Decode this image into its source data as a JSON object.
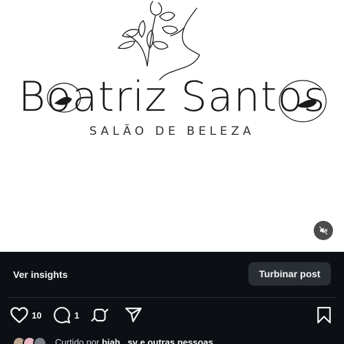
{
  "post": {
    "brand_name": "Boatriz Santos",
    "brand_subtitle": "SALÃO DE BELEZA",
    "mute_icon": "speaker-muted-icon"
  },
  "insights_bar": {
    "ver_insights_label": "Ver insights",
    "boost_label": "Turbinar post"
  },
  "actions": {
    "likes_count": "10",
    "comments_count": "1",
    "icons": [
      "heart-icon",
      "comment-icon",
      "repost-icon",
      "share-icon",
      "bookmark-icon"
    ]
  },
  "liked_by": {
    "prefix": "Curtido por",
    "user": "biah._sv",
    "suffix": "e outras pessoas"
  },
  "colors": {
    "background": "#0c0f14",
    "button_bg": "#2a2f36",
    "text": "#f5f5f5"
  }
}
